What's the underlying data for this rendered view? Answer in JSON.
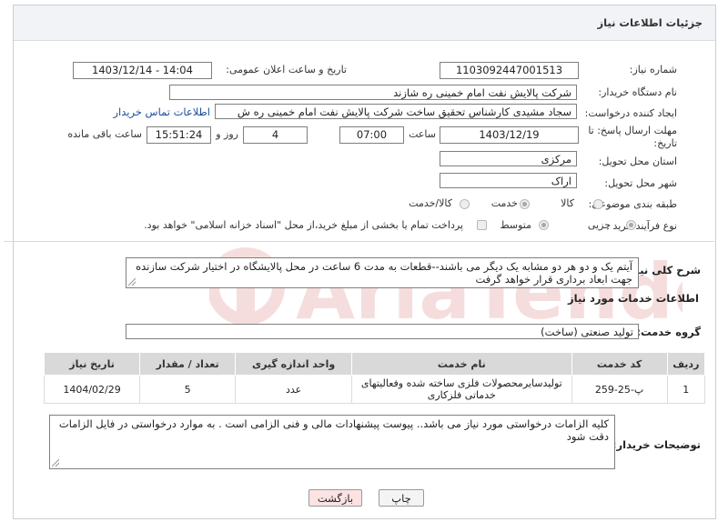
{
  "header": {
    "title": "جزئیات اطلاعات نیاز"
  },
  "form": {
    "need_number_label": "شماره نیاز:",
    "need_number": "1103092447001513",
    "announce_label": "تاریخ و ساعت اعلان عمومی:",
    "announce_value": "1403/12/14 - 14:04",
    "buyer_label": "نام دستگاه خریدار:",
    "buyer_value": "شرکت پالایش نفت امام خمینی  ره  شازند",
    "creator_label": "ایجاد کننده درخواست:",
    "creator_value": "سجاد مشیدی  کارشناس تحقیق ساخت شرکت پالایش نفت امام خمینی  ره  ش",
    "contact_link": "اطلاعات تماس خریدار",
    "deadline_label_1": "مهلت ارسال پاسخ: تا",
    "deadline_label_2": "تاریخ:",
    "deadline_date": "1403/12/19",
    "time_label": "ساعت",
    "deadline_time": "07:00",
    "days_value": "4",
    "days_label": "روز و",
    "remaining_time": "15:51:24",
    "remaining_label": "ساعت باقی مانده",
    "province_label": "استان محل تحویل:",
    "province_value": "مرکزی",
    "city_label": "شهر محل تحویل:",
    "city_value": "اراک",
    "category_label": "طبقه بندی موضوعی:",
    "category_options": [
      "کالا",
      "خدمت",
      "کالا/خدمت"
    ],
    "category_selected": "خدمت",
    "process_label": "نوع فرآیند خرید :",
    "process_options": [
      "جزیی",
      "متوسط"
    ],
    "process_selected": "جزیی",
    "payment_note": "پرداخت تمام یا بخشی از مبلغ خرید،از محل \"اسناد خزانه اسلامی\" خواهد بود."
  },
  "summary": {
    "label": "شرح کلی نیاز:",
    "text": "آیتم یک و دو هر دو مشابه یک دیگر می باشند--قطعات به مدت 6 ساعت در محل پالایشگاه در اختیار شرکت سازنده جهت ابعاد برداری قرار خواهد گرفت"
  },
  "services": {
    "section_title": "اطلاعات خدمات مورد نیاز",
    "group_label": "گروه خدمت:",
    "group_value": "تولید صنعتی (ساخت)",
    "columns": [
      "ردیف",
      "کد خدمت",
      "نام خدمت",
      "واحد اندازه گیری",
      "تعداد / مقدار",
      "تاریخ نیاز"
    ],
    "rows": [
      {
        "index": "1",
        "code": "پ-25-259",
        "name": "تولیدسایرمحصولات فلزی ساخته شده وفعالیتهای خدماتی فلزکاری",
        "unit": "عدد",
        "qty": "5",
        "date": "1404/02/29"
      }
    ]
  },
  "buyer_notes": {
    "label": "توضیحات خریدار:",
    "text": "کلیه الزامات درخواستی مورد نیاز می باشد.. پیوست پیشنهادات مالی و فنی الزامی است . به موارد درخواستی در فایل الزامات دقت شود"
  },
  "buttons": {
    "print": "چاپ",
    "back": "بازگشت"
  },
  "watermark": {
    "text": "AriaTender.neT"
  },
  "colors": {
    "link": "#1a4fa0",
    "back_button_bg": "#fbe3e3",
    "print_button_bg": "#f4f4f4",
    "table_header_bg": "#d9d9d9"
  }
}
